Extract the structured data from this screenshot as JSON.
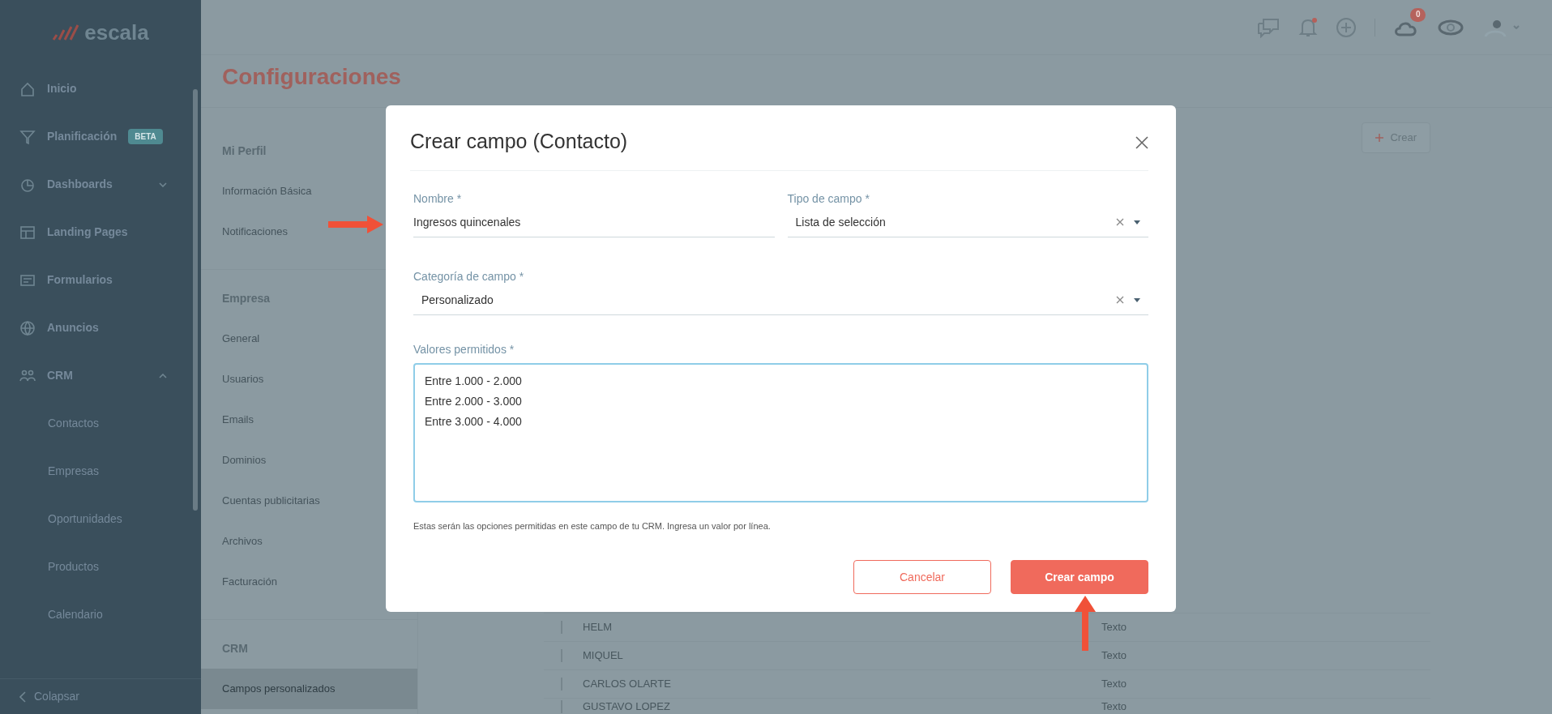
{
  "sidebar": {
    "logo": "escala",
    "items": [
      {
        "kind": "main",
        "label": "Inicio"
      },
      {
        "kind": "main",
        "label": "Planificación",
        "badge": "BETA"
      },
      {
        "kind": "main",
        "label": "Dashboards",
        "expanded": false
      },
      {
        "kind": "main",
        "label": "Landing Pages"
      },
      {
        "kind": "main",
        "label": "Formularios"
      },
      {
        "kind": "main",
        "label": "Anuncios"
      },
      {
        "kind": "main",
        "label": "CRM",
        "expanded": true
      },
      {
        "kind": "sub",
        "label": "Contactos"
      },
      {
        "kind": "sub",
        "label": "Empresas"
      },
      {
        "kind": "sub",
        "label": "Oportunidades"
      },
      {
        "kind": "sub",
        "label": "Productos"
      },
      {
        "kind": "sub",
        "label": "Calendario"
      }
    ],
    "collapse": "Colapsar"
  },
  "header": {
    "cloud_badge": "0"
  },
  "page_title": "Configuraciones",
  "settings_menu": [
    {
      "kind": "heading",
      "label": "Mi Perfil"
    },
    {
      "kind": "item",
      "label": "Información Básica",
      "selected": false
    },
    {
      "kind": "item",
      "label": "Notificaciones",
      "selected": false
    },
    {
      "kind": "heading",
      "label": "Empresa"
    },
    {
      "kind": "item",
      "label": "General",
      "selected": false
    },
    {
      "kind": "item",
      "label": "Usuarios",
      "selected": false
    },
    {
      "kind": "item",
      "label": "Emails",
      "selected": false
    },
    {
      "kind": "item",
      "label": "Dominios",
      "selected": false
    },
    {
      "kind": "item",
      "label": "Cuentas publicitarias",
      "selected": false
    },
    {
      "kind": "item",
      "label": "Archivos",
      "selected": false
    },
    {
      "kind": "item",
      "label": "Facturación",
      "selected": false
    },
    {
      "kind": "heading",
      "label": "CRM"
    },
    {
      "kind": "item",
      "label": "Campos personalizados",
      "selected": true
    }
  ],
  "create_button": "Crear",
  "table": {
    "rows": [
      {
        "name": "HELM",
        "type": "Texto"
      },
      {
        "name": "MIQUEL",
        "type": "Texto"
      },
      {
        "name": "CARLOS OLARTE",
        "type": "Texto"
      },
      {
        "name": "GUSTAVO LOPEZ",
        "type": "Texto"
      }
    ]
  },
  "modal": {
    "title": "Crear campo (Contacto)",
    "fields": [
      {
        "kind": "text",
        "label": "Nombre *",
        "value": "Ingresos quincenales"
      },
      {
        "kind": "select",
        "label": "Tipo de campo *",
        "value": "Lista de selección"
      },
      {
        "kind": "select",
        "label": "Categoría de campo *",
        "value": "Personalizado"
      },
      {
        "kind": "textarea",
        "label": "Valores permitidos *",
        "value": "Entre 1.000 - 2.000\nEntre 2.000 - 3.000\nEntre 3.000 - 4.000",
        "help": "Estas serán las opciones permitidas en este campo de tu CRM. Ingresa un valor por línea."
      }
    ],
    "buttons": [
      {
        "kind": "secondary",
        "label": "Cancelar"
      },
      {
        "kind": "primary",
        "label": "Crear campo"
      }
    ]
  }
}
